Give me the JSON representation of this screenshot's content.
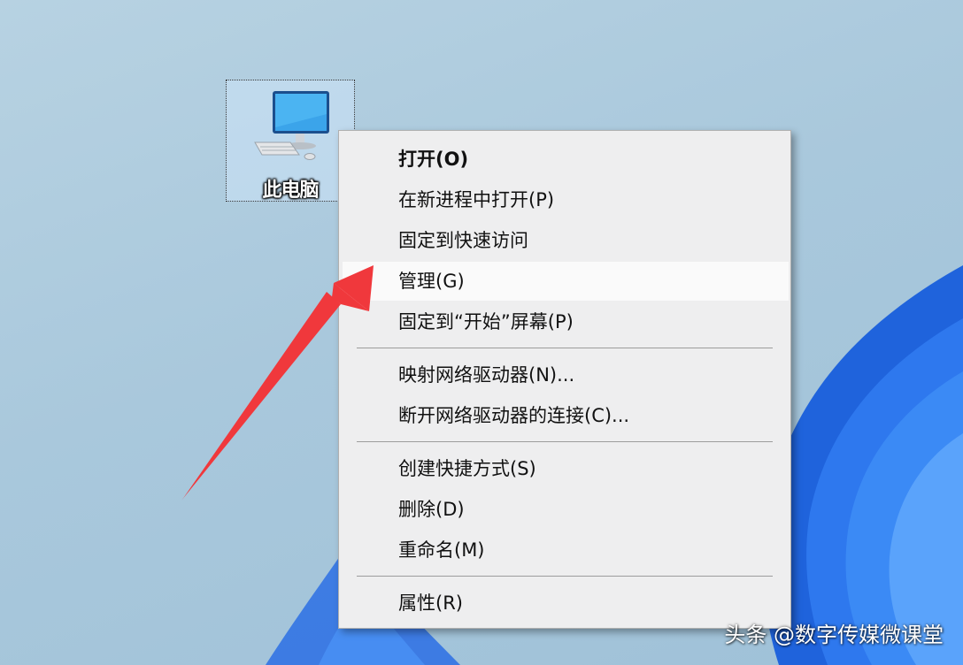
{
  "desktop": {
    "icon_label": "此电脑",
    "accent_color": "#1e5fd8"
  },
  "context_menu": {
    "items": [
      {
        "label": "打开(O)",
        "bold": true
      },
      {
        "label": "在新进程中打开(P)"
      },
      {
        "label": "固定到快速访问"
      },
      {
        "label": "管理(G)",
        "highlighted": true
      },
      {
        "label": "固定到“开始”屏幕(P)"
      },
      {
        "label": "映射网络驱动器(N)..."
      },
      {
        "label": "断开网络驱动器的连接(C)..."
      },
      {
        "label": "创建快捷方式(S)"
      },
      {
        "label": "删除(D)"
      },
      {
        "label": "重命名(M)"
      },
      {
        "label": "属性(R)"
      }
    ]
  },
  "annotation": {
    "arrow_color": "#f0383c"
  },
  "watermark": "头条 @数字传媒微课堂"
}
